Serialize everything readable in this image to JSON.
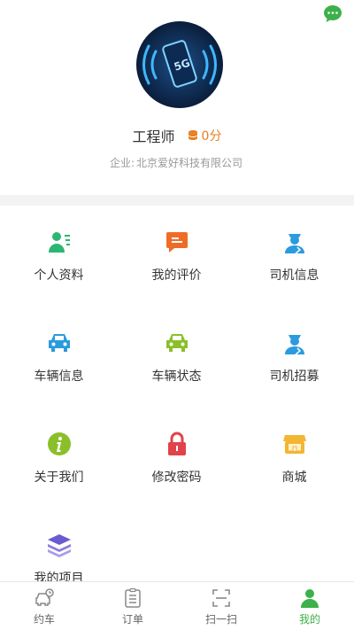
{
  "profile": {
    "name": "工程师",
    "points": "0分",
    "company_label": "企业:",
    "company_name": "北京爱好科技有限公司"
  },
  "menu": [
    {
      "label": "个人资料",
      "icon": "person-card-icon"
    },
    {
      "label": "我的评价",
      "icon": "comment-icon"
    },
    {
      "label": "司机信息",
      "icon": "driver-icon"
    },
    {
      "label": "车辆信息",
      "icon": "car-icon"
    },
    {
      "label": "车辆状态",
      "icon": "car-status-icon"
    },
    {
      "label": "司机招募",
      "icon": "driver-recruit-icon"
    },
    {
      "label": "关于我们",
      "icon": "info-icon"
    },
    {
      "label": "修改密码",
      "icon": "lock-icon"
    },
    {
      "label": "商城",
      "icon": "shop-icon"
    },
    {
      "label": "我的项目",
      "icon": "layers-icon"
    }
  ],
  "tabs": [
    {
      "label": "约车",
      "icon": "car-clock-icon"
    },
    {
      "label": "订单",
      "icon": "clipboard-icon"
    },
    {
      "label": "扫一扫",
      "icon": "scan-icon"
    },
    {
      "label": "我的",
      "icon": "user-icon",
      "active": true
    }
  ],
  "colors": {
    "accent": "#3cb04a",
    "points": "#e67e22",
    "blue": "#2a9bde",
    "green": "#8bbf2a",
    "red": "#e0434a",
    "orange": "#ef6c27",
    "yellow": "#f2b632",
    "purple": "#6b5bd0"
  }
}
